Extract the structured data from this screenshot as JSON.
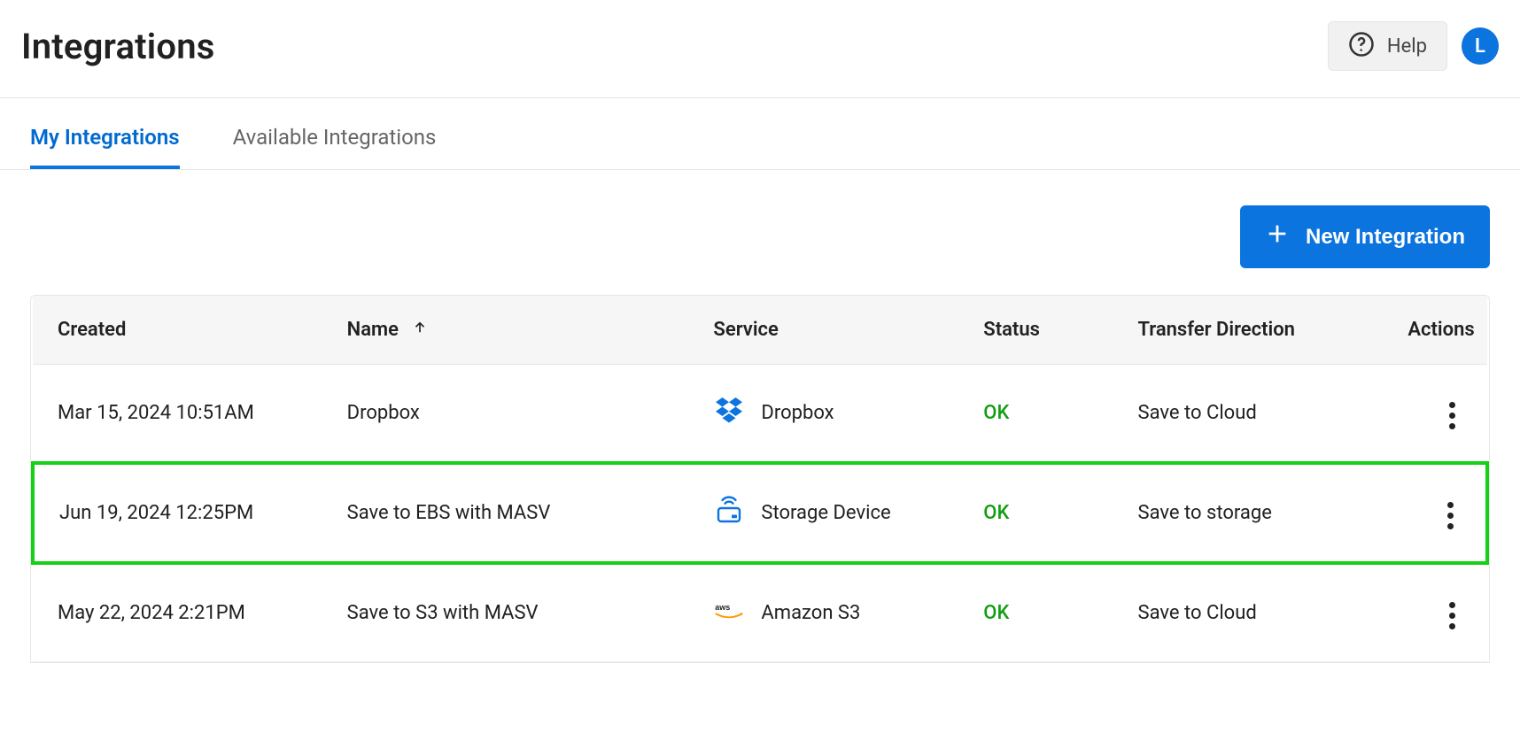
{
  "header": {
    "title": "Integrations",
    "help_label": "Help",
    "avatar_initial": "L"
  },
  "tabs": {
    "my": "My Integrations",
    "available": "Available Integrations",
    "active": "my"
  },
  "toolbar": {
    "new_label": "New Integration"
  },
  "table": {
    "columns": {
      "created": "Created",
      "name": "Name",
      "service": "Service",
      "status": "Status",
      "direction": "Transfer Direction",
      "actions": "Actions"
    },
    "sort": {
      "column": "name",
      "dir": "asc"
    },
    "rows": [
      {
        "created": "Mar 15, 2024 10:51AM",
        "name": "Dropbox",
        "service": "Dropbox",
        "service_icon": "dropbox-icon",
        "status": "OK",
        "direction": "Save to Cloud",
        "highlighted": false
      },
      {
        "created": "Jun 19, 2024 12:25PM",
        "name": "Save to EBS with MASV",
        "service": "Storage Device",
        "service_icon": "storage-device-icon",
        "status": "OK",
        "direction": "Save to storage",
        "highlighted": true
      },
      {
        "created": "May 22, 2024 2:21PM",
        "name": "Save to S3 with MASV",
        "service": "Amazon S3",
        "service_icon": "aws-icon",
        "status": "OK",
        "direction": "Save to Cloud",
        "highlighted": false
      }
    ]
  },
  "colors": {
    "accent": "#0b74de",
    "status_ok": "#129e12",
    "highlight": "#15d015"
  }
}
